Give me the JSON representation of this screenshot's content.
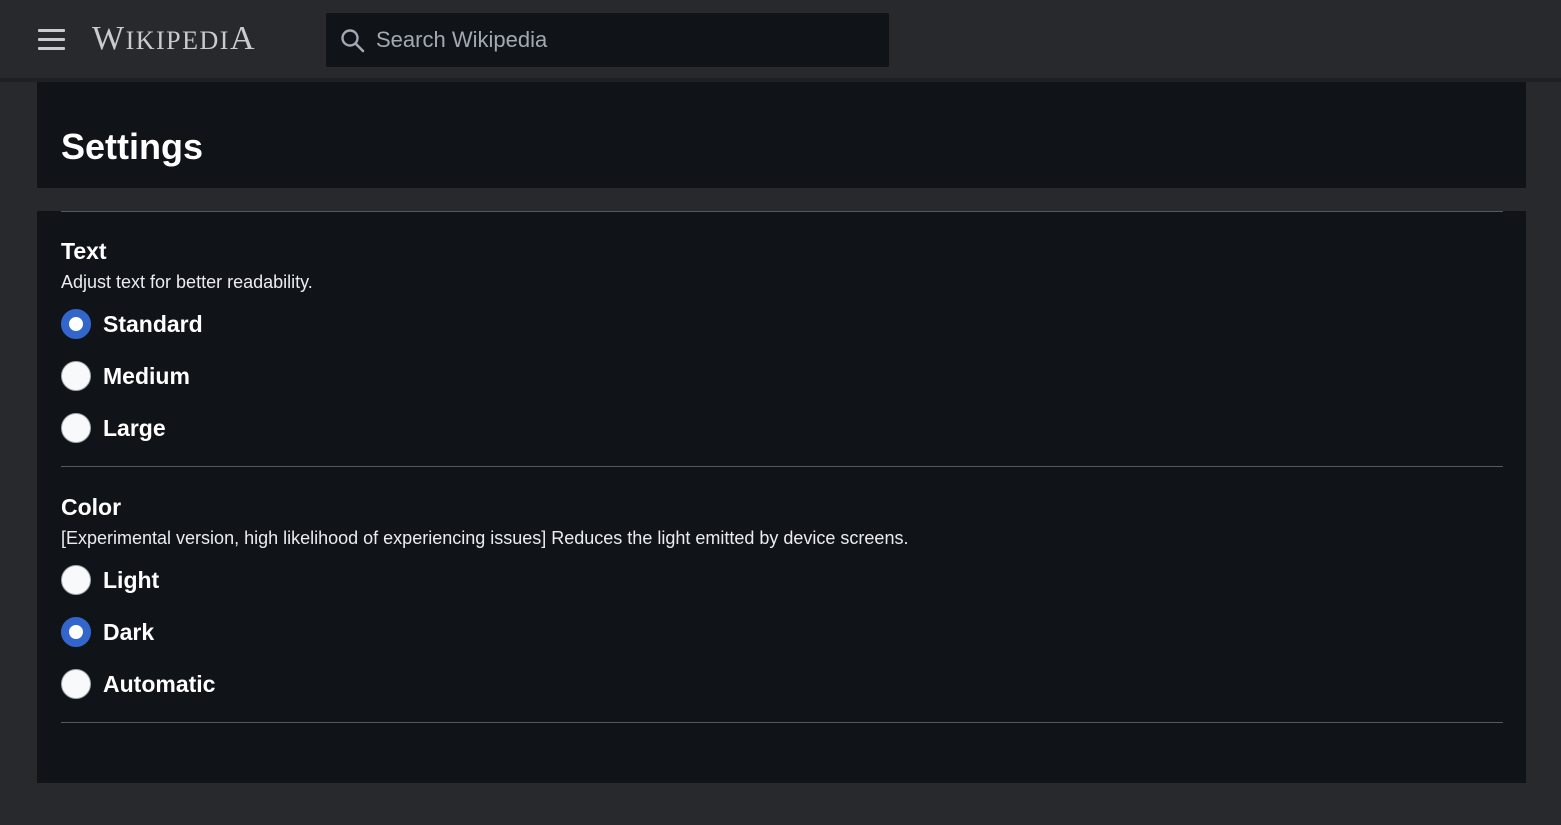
{
  "header": {
    "logo_first": "W",
    "logo_middle": "IKIPEDI",
    "logo_last": "A",
    "search_placeholder": "Search Wikipedia",
    "menu_icon": "hamburger-menu-icon",
    "search_icon": "search-icon"
  },
  "page": {
    "title": "Settings"
  },
  "sections": [
    {
      "heading": "Text",
      "description": "Adjust text for better readability.",
      "selected": "Standard",
      "options": [
        {
          "label": "Standard",
          "checked": true
        },
        {
          "label": "Medium",
          "checked": false
        },
        {
          "label": "Large",
          "checked": false
        }
      ]
    },
    {
      "heading": "Color",
      "description": "[Experimental version, high likelihood of experiencing issues] Reduces the light emitted by device screens.",
      "selected": "Dark",
      "options": [
        {
          "label": "Light",
          "checked": false
        },
        {
          "label": "Dark",
          "checked": true
        },
        {
          "label": "Automatic",
          "checked": false
        }
      ]
    }
  ],
  "colors": {
    "accent": "#3366cc",
    "background": "#27292d",
    "panel": "#101418",
    "text": "#ffffff"
  }
}
